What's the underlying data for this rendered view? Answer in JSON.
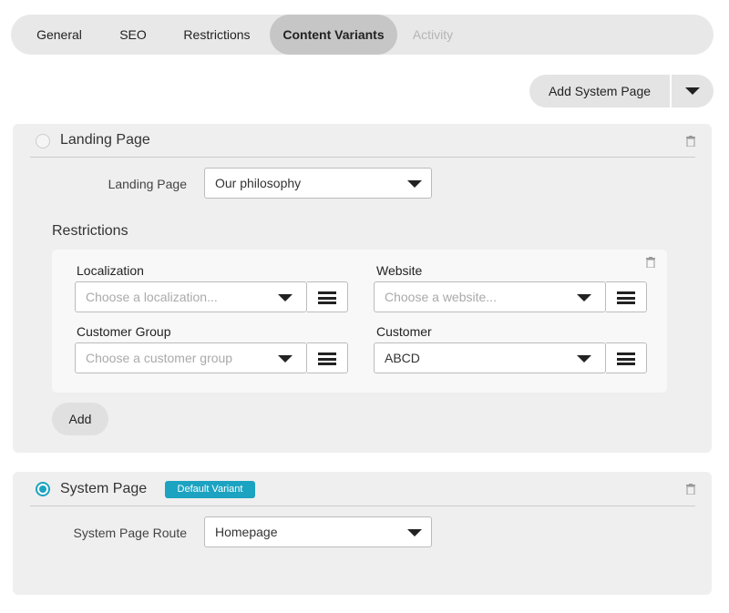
{
  "tabs": [
    {
      "label": "General"
    },
    {
      "label": "SEO"
    },
    {
      "label": "Restrictions"
    },
    {
      "label": "Content Variants",
      "active": true
    },
    {
      "label": "Activity",
      "disabled": true
    }
  ],
  "toolbar": {
    "add_label": "Add System Page"
  },
  "variants": [
    {
      "title": "Landing Page",
      "selected": false,
      "field_label": "Landing Page",
      "field_value": "Our philosophy",
      "restrictions": {
        "title": "Restrictions",
        "fields": [
          {
            "label": "Localization",
            "placeholder": "Choose a localization...",
            "value": ""
          },
          {
            "label": "Website",
            "placeholder": "Choose a website...",
            "value": ""
          },
          {
            "label": "Customer Group",
            "placeholder": "Choose a customer group",
            "value": ""
          },
          {
            "label": "Customer",
            "placeholder": "",
            "value": "ABCD"
          }
        ],
        "add_label": "Add"
      }
    },
    {
      "title": "System Page",
      "selected": true,
      "badge": "Default Variant",
      "field_label": "System Page Route",
      "field_value": "Homepage"
    }
  ],
  "colors": {
    "accent": "#1ba3c1",
    "panel": "#efefef"
  }
}
